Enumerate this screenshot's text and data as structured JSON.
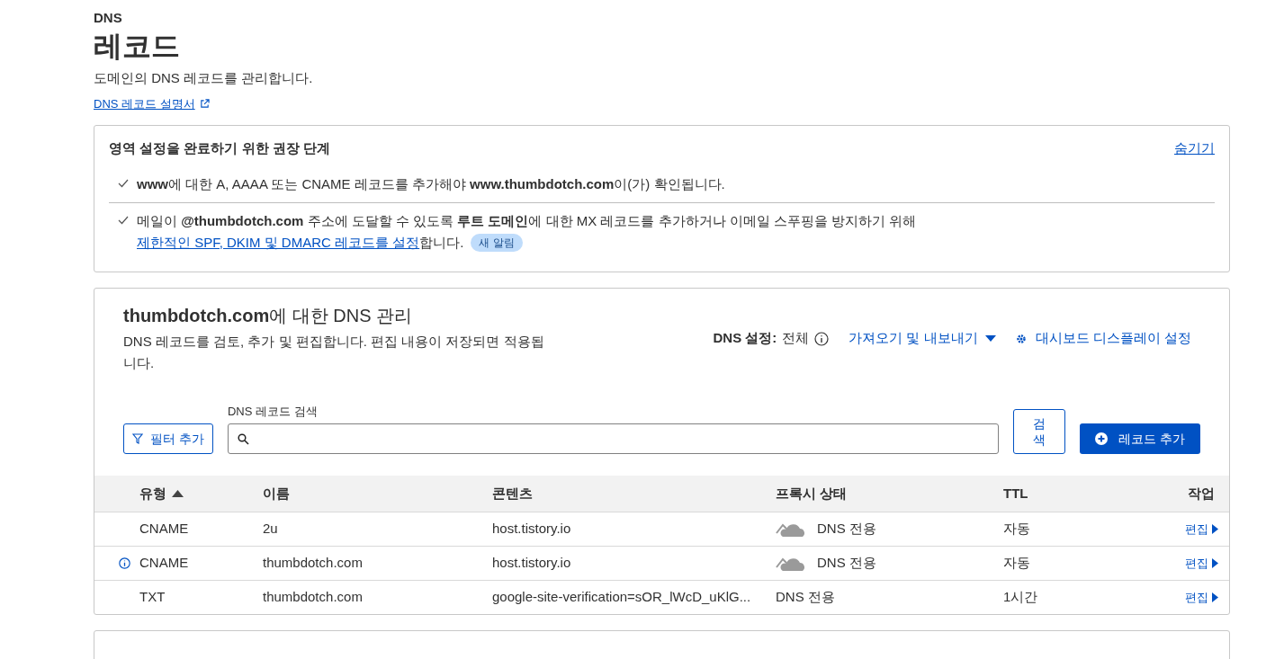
{
  "header": {
    "eyebrow": "DNS",
    "title": "레코드",
    "description": "도메인의 DNS 레코드를 관리합니다.",
    "docs_link": "DNS 레코드 설명서"
  },
  "recommendations": {
    "title": "영역 설정을 완료하기 위한 권장 단계",
    "hide_link": "숨기기",
    "steps": [
      {
        "text": "**www**에 대한 A, AAAA 또는 CNAME 레코드를 추가해야 **www.thumbdotch.com**이(가) 확인됩니다."
      },
      {
        "text": "메일이 **@thumbdotch.com** 주소에 도달할 수 있도록 **루트 도메인**에 대한 MX 레코드를 추가하거나 이메일 스푸핑을 방지하기 위해",
        "link": "제한적인 SPF, DKIM 및 DMARC 레코드를 설정",
        "suffix": "합니다.",
        "badge": "새 알림"
      }
    ]
  },
  "dns_panel": {
    "title": "**thumbdotch.com**에 대한 DNS 관리",
    "description": "DNS 레코드를 검토, 추가 및 편집합니다. 편집 내용이 저장되면 적용됩니다.",
    "setting_label": "DNS 설정:",
    "setting_value": "전체",
    "import_export": "가져오기 및 내보내기",
    "dashboard_settings": "대시보드 디스플레이 설정",
    "filter_button": "필터 추가",
    "search_label": "DNS 레코드 검색",
    "search_button": "검색",
    "add_button": "레코드 추가"
  },
  "table": {
    "columns": [
      {
        "label": "유형",
        "sorted": true
      },
      {
        "label": "이름",
        "sorted": false
      },
      {
        "label": "콘텐츠",
        "sorted": false
      },
      {
        "label": "프록시 상태",
        "sorted": false
      },
      {
        "label": "TTL",
        "sorted": false
      },
      {
        "label": "작업",
        "sorted": false
      }
    ],
    "rows": [
      {
        "info": false,
        "type": "CNAME",
        "name": "2u",
        "content": "host.tistory.io",
        "cloud": true,
        "proxy": "DNS 전용",
        "ttl": "자동",
        "action": "편집"
      },
      {
        "info": true,
        "type": "CNAME",
        "name": "thumbdotch.com",
        "content": "host.tistory.io",
        "cloud": true,
        "proxy": "DNS 전용",
        "ttl": "자동",
        "action": "편집"
      },
      {
        "info": false,
        "type": "TXT",
        "name": "thumbdotch.com",
        "content": "google-site-verification=sOR_lWcD_uKlG...",
        "cloud": false,
        "proxy": "DNS 전용",
        "ttl": "1시간",
        "action": "편집"
      }
    ]
  }
}
